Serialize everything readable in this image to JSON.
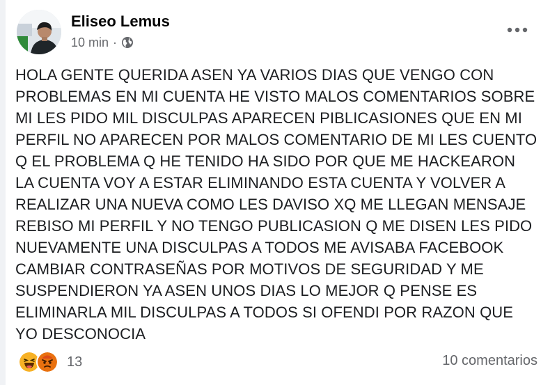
{
  "post": {
    "author": "Eliseo Lemus",
    "time": "10 min",
    "separator": "·",
    "privacy_icon": "globe-icon",
    "menu_icon": "more-options-icon",
    "text_lines": [
      "HOLA GENTE QUERIDA ASEN YA VARIOS DIAS QUE VENGO CON",
      "PROBLEMAS EN MI CUENTA HE VISTO MALOS COMENTARIOS SOBRE",
      "MI LES PIDO MIL DISCULPAS APARECEN PIBLICASIONES QUE EN MI",
      "PERFIL NO APARECEN POR MALOS COMENTARIO DE MI LES CUENTO",
      "Q EL PROBLEMA Q HE TENIDO HA SIDO POR QUE ME HACKEARON",
      "LA CUENTA VOY A ESTAR ELIMINANDO ESTA CUENTA Y VOLVER A",
      "REALIZAR UNA NUEVA COMO LES DAVISO XQ ME LLEGAN MENSAJE",
      "REBISO MI PERFIL Y NO TENGO PUBLICASION Q ME DISEN LES PIDO",
      "NUEVAMENTE UNA DISCULPAS A TODOS ME AVISABA FACEBOOK",
      "CAMBIAR CONTRASEÑAS POR MOTIVOS DE SEGURIDAD Y ME",
      "SUSPENDIERON YA ASEN UNOS DIAS LO MEJOR Q PENSE ES",
      "ELIMINARLA MIL DISCULPAS A TODOS SI OFENDI POR RAZON QUE",
      "YO DESCONOCIA"
    ]
  },
  "footer": {
    "reaction_icons": [
      "haha-reaction-icon",
      "angry-reaction-icon"
    ],
    "reaction_count": "13",
    "comments_label": "10 comentarios"
  },
  "colors": {
    "secondary_text": "#65676b",
    "haha_yellow": "#f7b125",
    "angry_orange": "#e9710f"
  }
}
